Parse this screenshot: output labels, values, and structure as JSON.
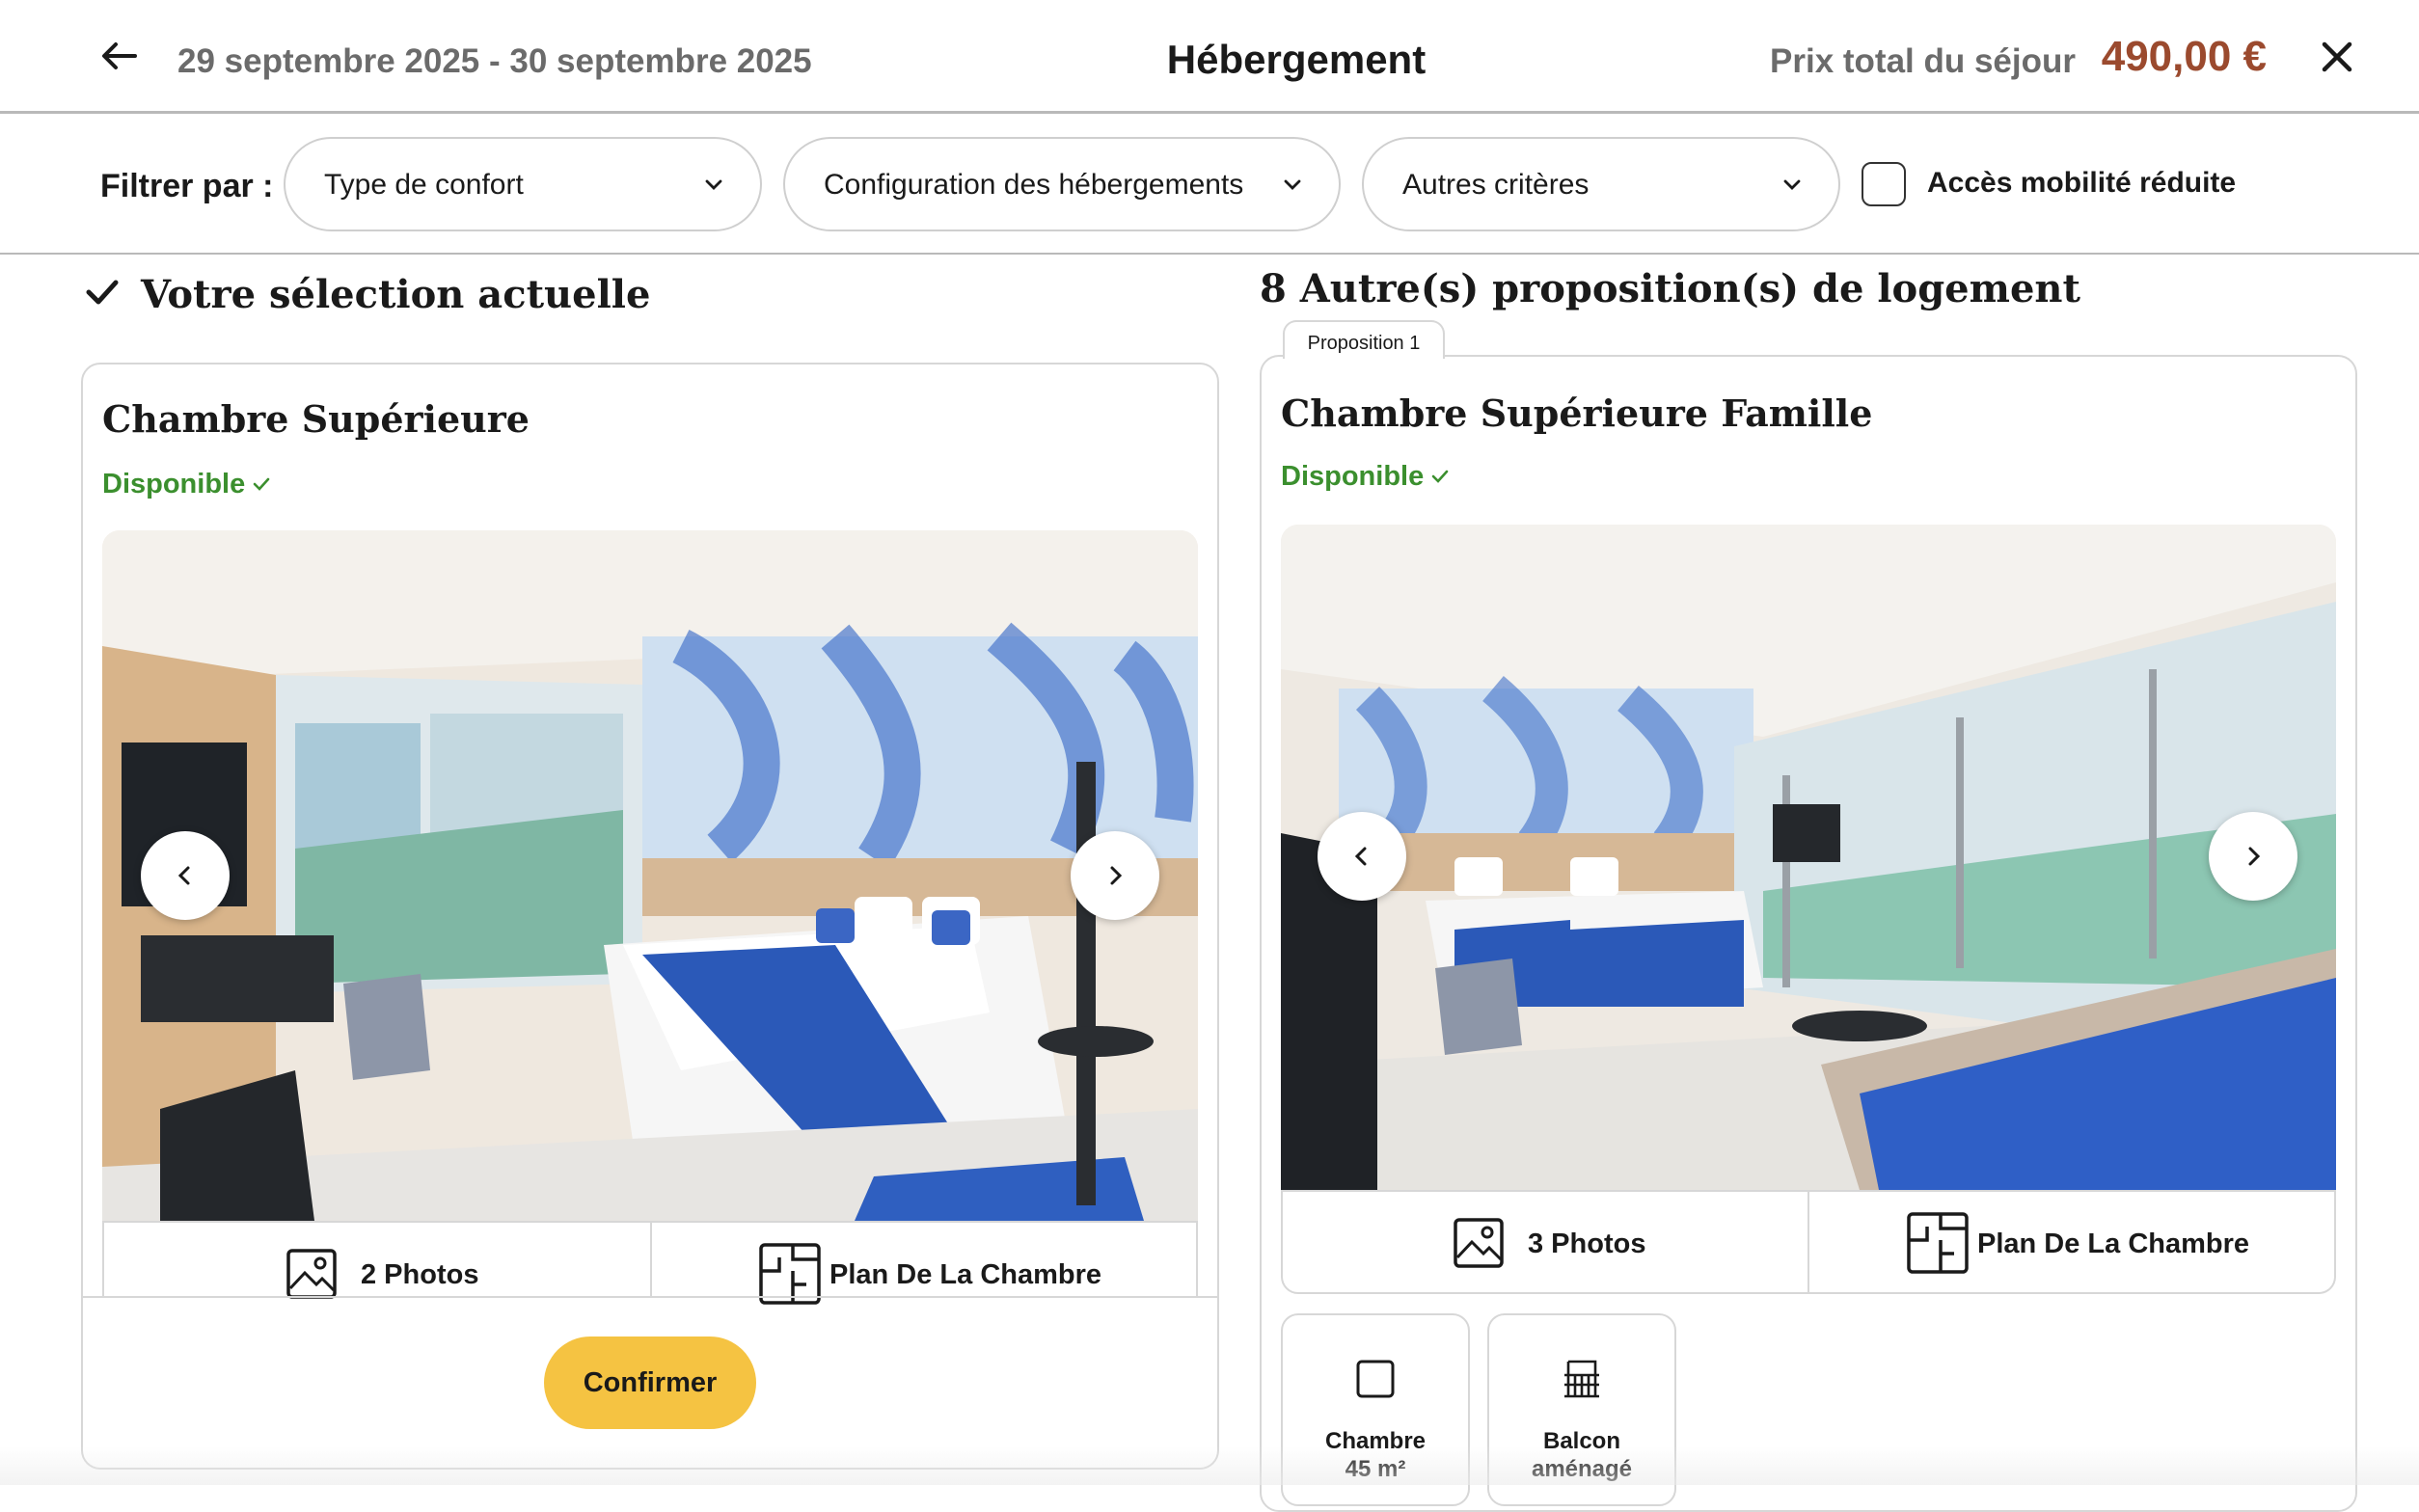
{
  "header": {
    "dates": "29 septembre 2025 - 30 septembre 2025",
    "title": "Hébergement",
    "price_label": "Prix total du séjour",
    "price_value": "490,00 €",
    "price_color": "#9b4a2e"
  },
  "filters": {
    "label": "Filtrer par :",
    "dropdowns": [
      {
        "label": "Type de confort"
      },
      {
        "label": "Configuration des hébergements"
      },
      {
        "label": "Autres critères"
      }
    ],
    "checkbox_label": "Accès mobilité réduite",
    "checkbox_checked": false
  },
  "current_selection": {
    "heading": "Votre sélection actuelle",
    "room": {
      "title": "Chambre Supérieure",
      "availability": "Disponible",
      "photos_label": "2 Photos",
      "plan_label": "Plan De La Chambre"
    },
    "confirm_label": "Confirmer",
    "confirm_color": "#f5c342"
  },
  "other_proposals": {
    "heading": "8 Autre(s) proposition(s) de logement",
    "tab_label": "Proposition 1",
    "room": {
      "title": "Chambre Supérieure Famille",
      "availability": "Disponible",
      "photos_label": "3 Photos",
      "plan_label": "Plan De La Chambre"
    },
    "amenities": [
      {
        "icon": "room-size-icon",
        "line1": "Chambre",
        "line2": "45 m²"
      },
      {
        "icon": "balcony-icon",
        "line1": "Balcon",
        "line2": "aménagé"
      }
    ]
  },
  "icons": {
    "back": "arrow-left-icon",
    "close": "close-icon",
    "available": "check-icon",
    "photos": "image-icon",
    "plan": "floor-plan-icon",
    "prev": "chevron-left-icon",
    "next": "chevron-right-icon"
  },
  "colors": {
    "available_green": "#3b8f2e",
    "border": "#d7d7d7"
  }
}
